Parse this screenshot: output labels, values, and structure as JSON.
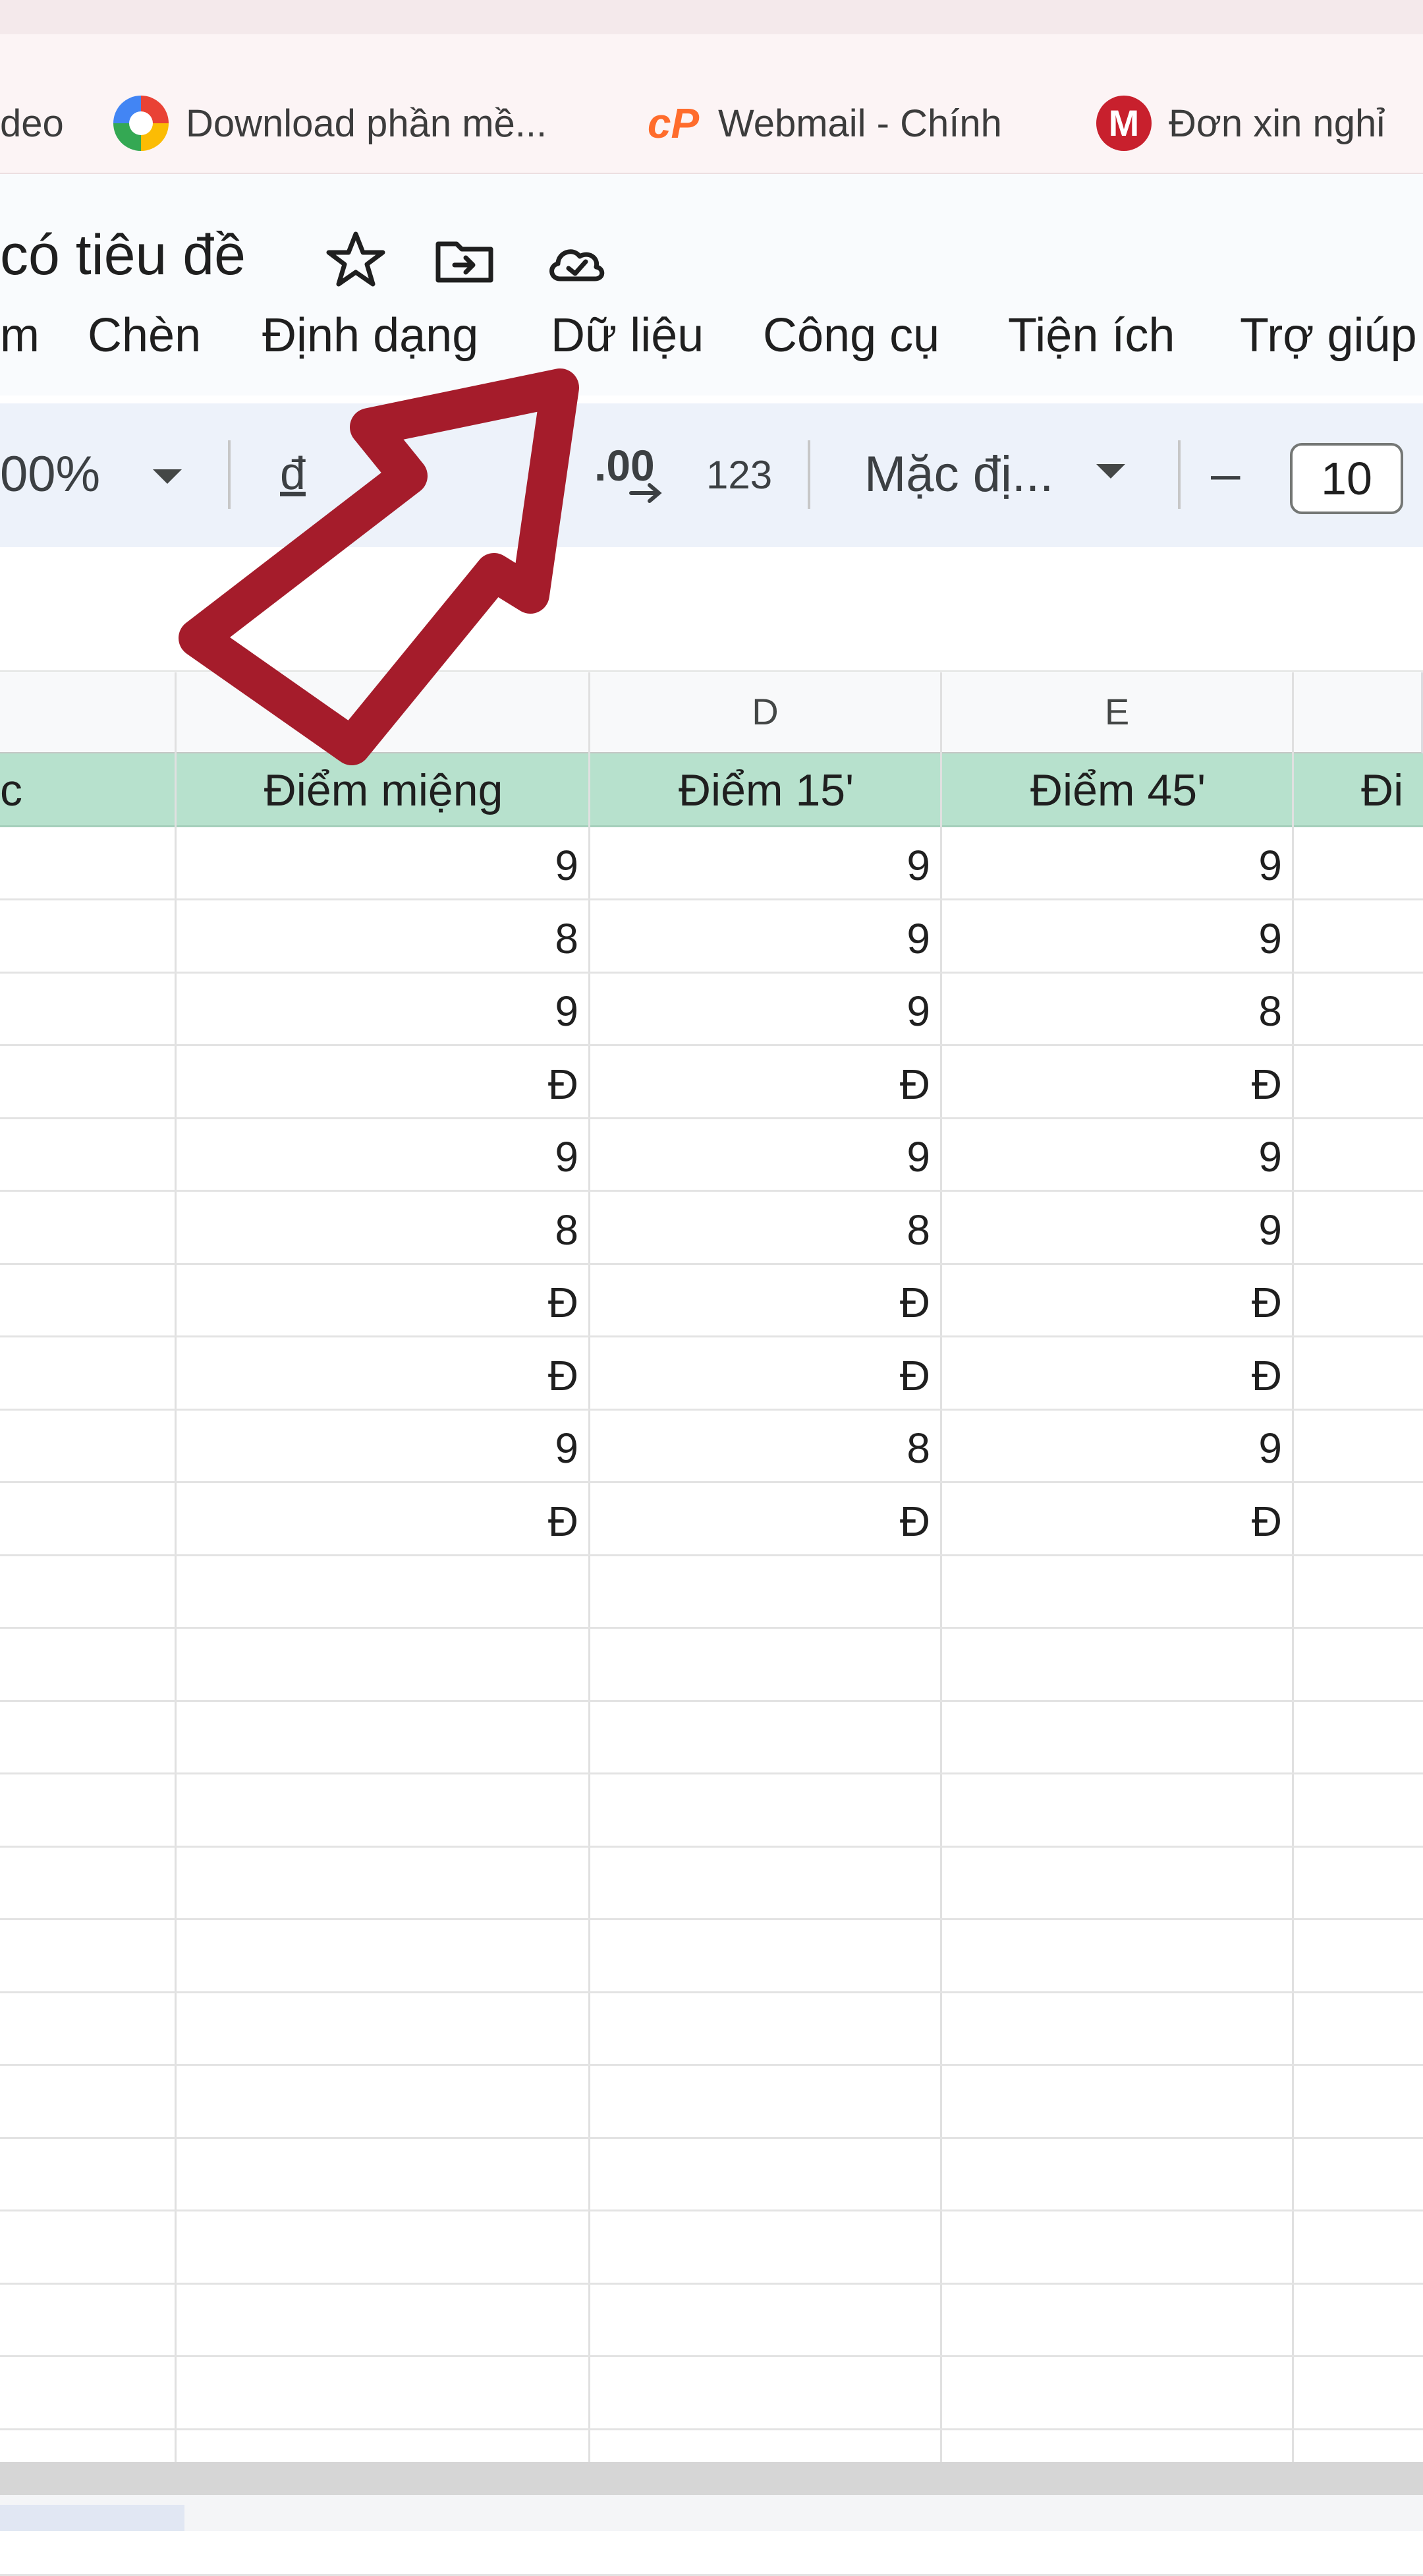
{
  "bookmarks": [
    {
      "label": "deo",
      "icon": "none"
    },
    {
      "label": "Download phần mề...",
      "icon": "pinwheel-icon"
    },
    {
      "label": "Webmail - Chính",
      "icon": "cpanel-icon"
    },
    {
      "label": "Đơn xin nghỉ",
      "icon": "m-icon"
    }
  ],
  "doc": {
    "title": "có tiêu đề",
    "icons": [
      "star-icon",
      "move-to-folder-icon",
      "cloud-saved-icon"
    ]
  },
  "menu": {
    "m": "m",
    "insert": "Chèn",
    "format": "Định dạng",
    "data": "Dữ liệu",
    "tools": "Công cụ",
    "extensions": "Tiện ích",
    "help": "Trợ giúp"
  },
  "toolbar": {
    "zoom": "00%",
    "currency": "đ",
    "decimal": ".00",
    "number_format": "123",
    "font": "Mặc đị...",
    "minus": "–",
    "font_size": "10"
  },
  "sheet": {
    "columns": [
      "",
      "",
      "D",
      "E",
      ""
    ],
    "headers": [
      "c",
      "Điểm miệng",
      "Điểm 15'",
      "Điểm 45'",
      "Đi"
    ],
    "rows": [
      [
        "9",
        "9",
        "9"
      ],
      [
        "8",
        "9",
        "9"
      ],
      [
        "9",
        "9",
        "8"
      ],
      [
        "Đ",
        "Đ",
        "Đ"
      ],
      [
        "9",
        "9",
        "9"
      ],
      [
        "8",
        "8",
        "9"
      ],
      [
        "Đ",
        "Đ",
        "Đ"
      ],
      [
        "Đ",
        "Đ",
        "Đ"
      ],
      [
        "9",
        "8",
        "9"
      ],
      [
        "Đ",
        "Đ",
        "Đ"
      ]
    ]
  },
  "colors": {
    "header_fill": "#b7e1cd",
    "toolbar_bg": "#edf2fa",
    "arrow": "#a51c2b"
  }
}
